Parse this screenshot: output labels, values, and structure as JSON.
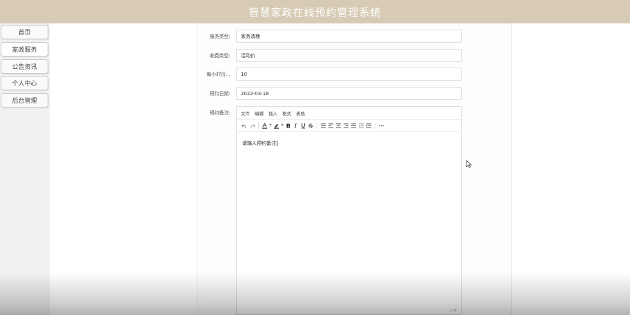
{
  "header": {
    "title": "智慧家政在线预约管理系统"
  },
  "sidebar": {
    "items": [
      {
        "label": "首页"
      },
      {
        "label": "家政服务"
      },
      {
        "label": "公告资讯"
      },
      {
        "label": "个人中心"
      },
      {
        "label": "后台管理"
      }
    ]
  },
  "form": {
    "service_type": {
      "label": "服务类型:",
      "value": "家务清理"
    },
    "charge_type": {
      "label": "收费类型:",
      "value": "活动价"
    },
    "hourly_price": {
      "label": "每小时价...",
      "value": "10"
    },
    "booking_date": {
      "label": "预约日期:",
      "value": "2022-03-18"
    },
    "remarks": {
      "label": "预约备注:"
    }
  },
  "editor": {
    "menu": [
      "文件",
      "编辑",
      "插入",
      "格式",
      "表格"
    ],
    "content": "请输入预约备注",
    "status": "1 字"
  },
  "icons": [
    "undo-icon",
    "redo-icon",
    "text-color-icon",
    "highlight-icon",
    "bold-icon",
    "italic-icon",
    "underline-icon",
    "strikethrough-icon",
    "line-height-icon",
    "align-left-icon",
    "align-center-icon",
    "align-right-icon",
    "align-justify-icon",
    "outdent-icon",
    "indent-icon",
    "more-icon",
    "mouse-pointer-icon"
  ],
  "colors": {
    "header_bg": "#d7cbb5",
    "header_text": "#ffffff"
  }
}
